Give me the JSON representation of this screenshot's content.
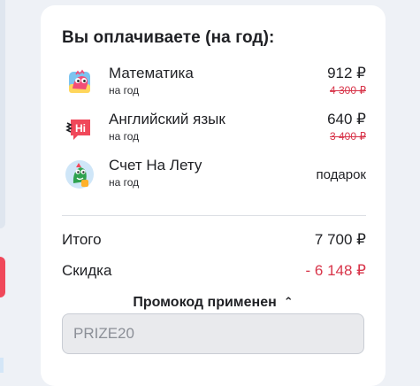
{
  "summary": {
    "title": "Вы оплачиваете (на год):",
    "items": [
      {
        "name": "Математика",
        "period": "на год",
        "price": "912 ₽",
        "old_price": "4 300 ₽",
        "icon": "dino-math-icon"
      },
      {
        "name": "Английский язык",
        "period": "на год",
        "price": "640 ₽",
        "old_price": "3 400 ₽",
        "icon": "hi-english-icon"
      },
      {
        "name": "Счет На Лету",
        "period": "на год",
        "price": "подарок",
        "icon": "dino-rocket-icon"
      }
    ],
    "total_label": "Итого",
    "total_value": "7 700 ₽",
    "discount_label": "Скидка",
    "discount_value": "- 6 148 ₽",
    "promo_toggle_label": "Промокод применен",
    "promo_code": "PRIZE20"
  },
  "colors": {
    "discount": "#d8354a",
    "old_price": "#d8354a",
    "brand_red": "#f0485a"
  }
}
